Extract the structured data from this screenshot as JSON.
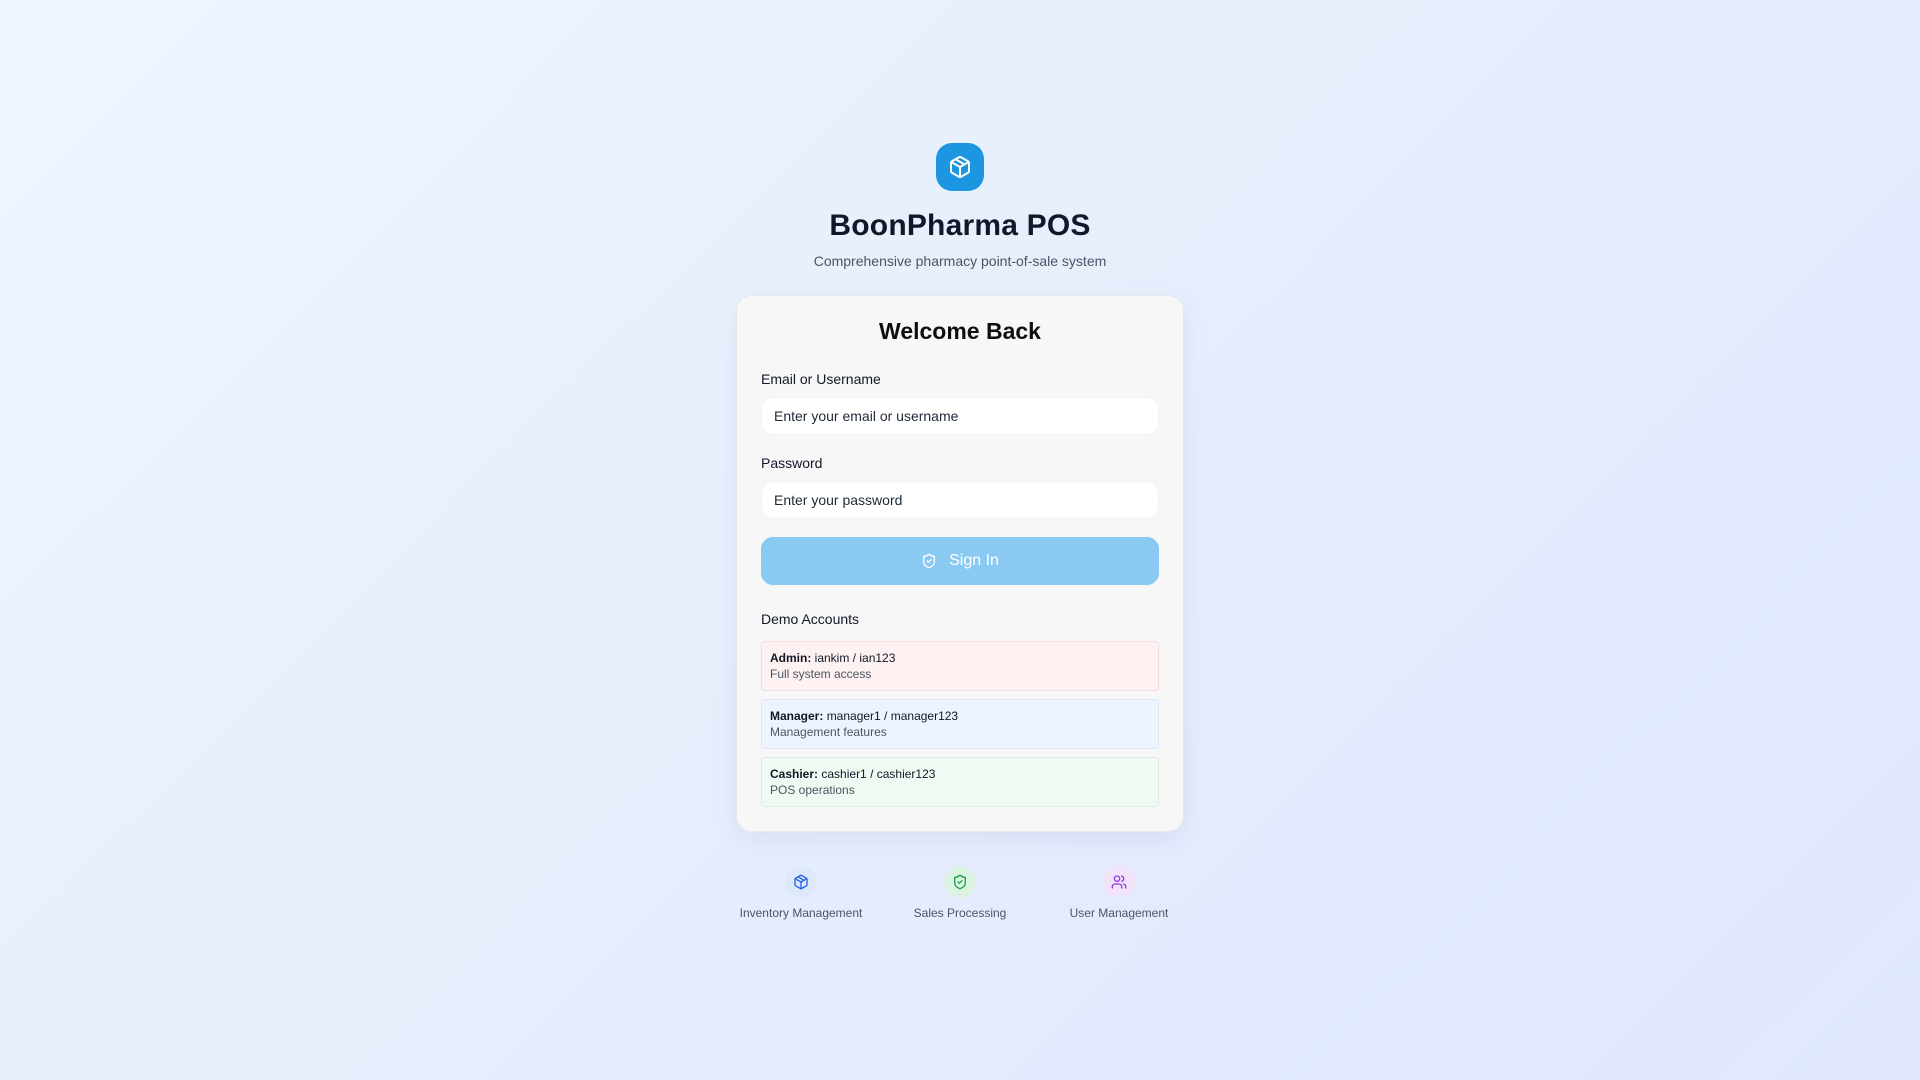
{
  "header": {
    "logo_icon": "package-icon",
    "title": "BoonPharma POS",
    "subtitle": "Comprehensive pharmacy point-of-sale system"
  },
  "login_card": {
    "title": "Welcome Back",
    "email_label": "Email or Username",
    "email_placeholder": "Enter your email or username",
    "email_value": "",
    "password_label": "Password",
    "password_placeholder": "Enter your password",
    "password_value": "",
    "signin_icon": "shield-check-icon",
    "signin_label": "Sign In"
  },
  "demo_accounts": {
    "title": "Demo Accounts",
    "items": [
      {
        "role": "Admin:",
        "credentials": "iankim / ian123",
        "description": "Full system access",
        "color": "#fdf1f1"
      },
      {
        "role": "Manager:",
        "credentials": "manager1 / manager123",
        "description": "Management features",
        "color": "#eef4fd"
      },
      {
        "role": "Cashier:",
        "credentials": "cashier1 / cashier123",
        "description": "POS operations",
        "color": "#effaf2"
      }
    ]
  },
  "features": [
    {
      "icon": "package-icon",
      "label": "Inventory Management",
      "color": "#2563eb"
    },
    {
      "icon": "shield-check-icon",
      "label": "Sales Processing",
      "color": "#16a34a"
    },
    {
      "icon": "users-icon",
      "label": "User Management",
      "color": "#9333ea"
    }
  ],
  "colors": {
    "brand": "#1d96e2",
    "signin_button": "#8ac9f1"
  }
}
